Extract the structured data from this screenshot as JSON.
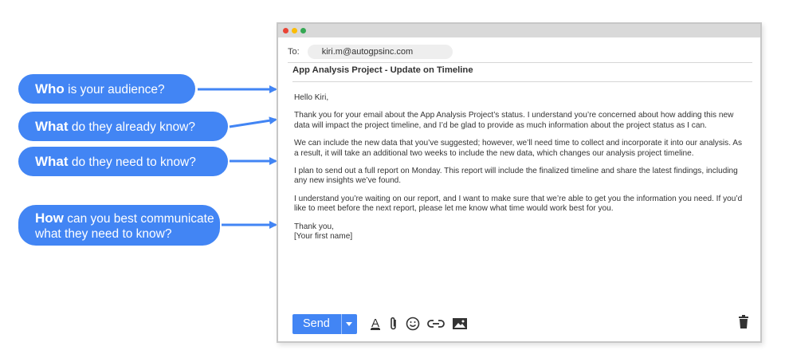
{
  "callouts": [
    {
      "bold": "Who",
      "rest": " is your audience?"
    },
    {
      "bold": "What",
      "rest": " do they already know?"
    },
    {
      "bold": "What",
      "rest": " do they need to know?"
    },
    {
      "bold": "How",
      "rest": " can you best communicate what they need to know?"
    }
  ],
  "email": {
    "to_label": "To:",
    "to_value": "kiri.m@autogpsinc.com",
    "subject": "App Analysis Project - Update on Timeline",
    "greeting": "Hello Kiri,",
    "paragraphs": [
      "Thank you for your email about the App Analysis Project’s status. I understand you’re concerned about how adding this new data will impact the project timeline, and I’d be glad to provide as much information about the project status as I can.",
      "We can include the new data that you’ve suggested; however, we’ll need time to collect and incorporate it into our analysis. As a result, it will take an additional two weeks to include the new data, which changes our analysis project timeline.",
      "I plan to send out a full report on Monday. This report will include the finalized timeline and share the latest findings, including any new insights we’ve found.",
      "I understand you’re waiting on our report, and I want to make sure that we’re able to get you the information you need. If you’d like to meet before the next report, please let me know what time would work best for you."
    ],
    "closing": "Thank you,\n[Your first name]"
  },
  "toolbar": {
    "send_label": "Send",
    "icons": [
      "format-text-icon",
      "attach-icon",
      "emoji-icon",
      "link-icon",
      "image-icon",
      "trash-icon"
    ]
  },
  "colors": {
    "accent": "#4285f4",
    "window_dots": [
      "#ea4335",
      "#fbbc05",
      "#34a853"
    ]
  }
}
